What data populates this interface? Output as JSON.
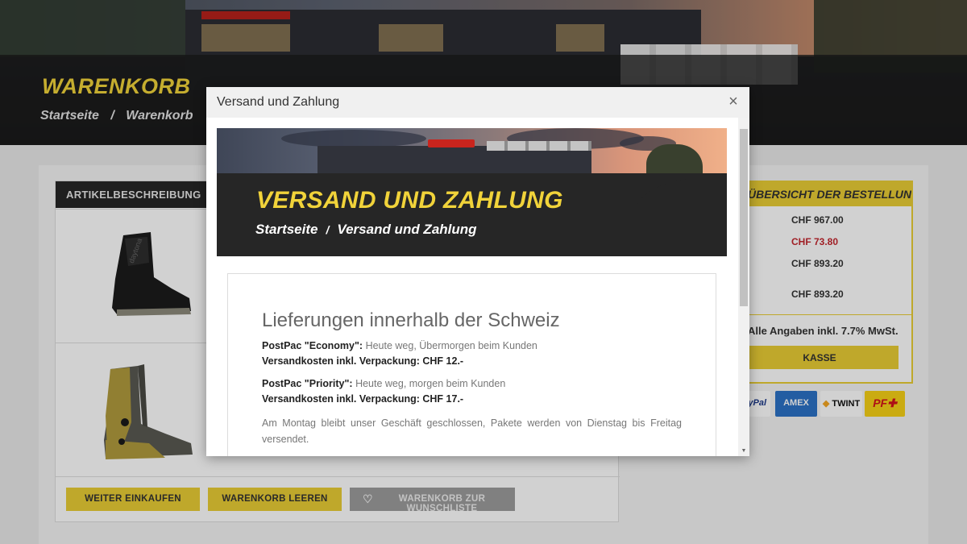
{
  "page": {
    "hero_title": "WARENKORB",
    "breadcrumb": [
      "Startseite",
      "/",
      "Warenkorb"
    ],
    "cart_header": "ARTIKELBESCHREIBUNG",
    "buttons": {
      "continue_shopping": "WEITER EINKAUFEN",
      "empty_cart": "WARENKORB LEEREN",
      "to_wishlist": "WARENKORB ZUR WUNSCHLISTE"
    },
    "summary": {
      "header": "ÜBERSICHT DER BESTELLUNG",
      "values": [
        "CHF 967.00",
        "CHF 73.80",
        "CHF 893.20",
        "CHF 893.20"
      ],
      "vat_note": "Alle Angaben inkl. 7.7% MwSt.",
      "checkout": "KASSE"
    },
    "payment_methods": [
      "PayPal",
      "AMEX",
      "TWINT",
      "PF"
    ]
  },
  "modal": {
    "title": "Versand und Zahlung",
    "close_glyph": "×",
    "banner_title": "VERSAND UND ZAHLUNG",
    "banner_crumb_home": "Startseite",
    "banner_crumb_sep": "/",
    "banner_crumb_current": "Versand und Zahlung",
    "heading": "Lieferungen innerhalb der Schweiz",
    "economy_label": "PostPac \"Economy\":",
    "economy_text": " Heute weg, Übermorgen beim Kunden",
    "economy_cost": "Versandkosten inkl. Verpackung: CHF 12.-",
    "priority_label": "PostPac \"Priority\":",
    "priority_text": " Heute weg, morgen beim Kunden",
    "priority_cost": "Versandkosten inkl. Verpackung: CHF 17.-",
    "monday_note": "Am Montag bleibt unser Geschäft geschlossen, Pakete werden von Dienstag bis Freitag versendet."
  },
  "colors": {
    "brand_yellow": "#f1d33a",
    "button_yellow": "#e9cd35",
    "discount_red": "#c4262e",
    "dark": "#262626"
  }
}
